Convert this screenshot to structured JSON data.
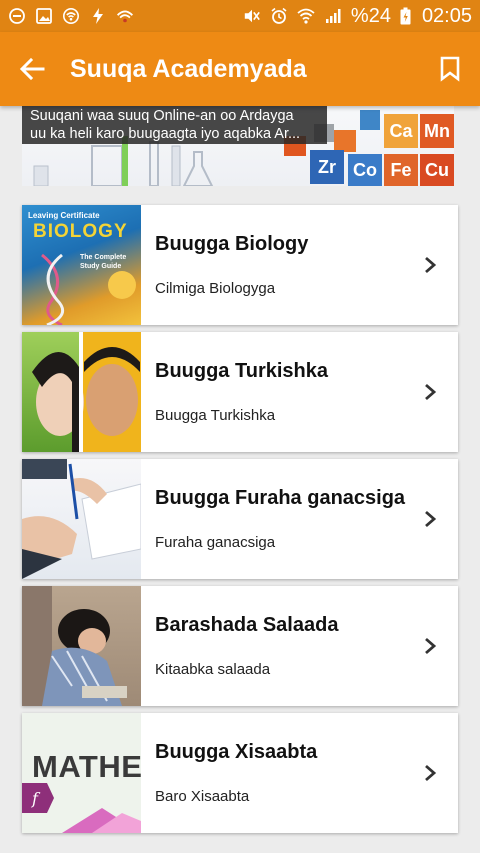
{
  "status_bar": {
    "battery_percent": "%24",
    "time": "02:05",
    "icons": [
      "minus-circle-icon",
      "image-icon",
      "wifi-hotspot-icon",
      "flash-icon",
      "signal-app-icon",
      "mute-icon",
      "alarm-icon",
      "wifi-icon",
      "cell-signal-icon",
      "battery-charging-icon"
    ]
  },
  "app_bar": {
    "title": "Suuqa Academyada",
    "back_icon": "arrow-left-icon",
    "bookmark_icon": "bookmark-icon"
  },
  "banner": {
    "caption_line1": "Suuqani waa suuq Online-an oo Ardayga",
    "caption_line2": "uu ka heli karo buugaagta iyo aqabka Ar...",
    "elements": [
      "Ca",
      "Mn",
      "Zr",
      "Co",
      "Fe",
      "Cu"
    ]
  },
  "items": [
    {
      "title": "Buugga Biology",
      "subtitle": "Cilmiga Biologyga",
      "thumb_text_top": "Leaving Certificate",
      "thumb_text_main": "BIOLOGY",
      "thumb_text_sub": "The Complete Study Guide"
    },
    {
      "title": "Buugga Turkishka",
      "subtitle": "Buugga Turkishka"
    },
    {
      "title": "Buugga Furaha ganacsiga",
      "subtitle": "Furaha ganacsiga"
    },
    {
      "title": "Barashada Salaada",
      "subtitle": "Kitaabka salaada"
    },
    {
      "title": "Buugga Xisaabta",
      "subtitle": "Baro Xisaabta",
      "thumb_text_main": "MATHE"
    }
  ],
  "colors": {
    "status_bar": "#e08413",
    "app_bar": "#ee8a14",
    "background": "#ececec"
  }
}
